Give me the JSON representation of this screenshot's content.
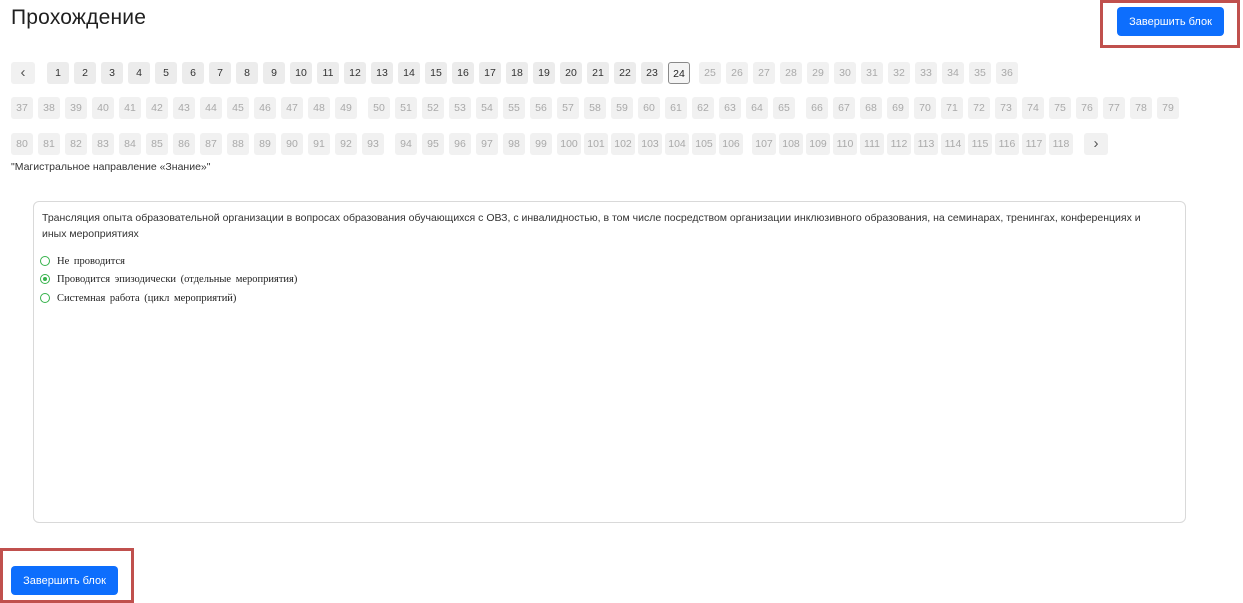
{
  "page": {
    "title": "Прохождение",
    "finish_button_label": "Завершить блок"
  },
  "pagination": {
    "current": 24,
    "rows": [
      {
        "items": [
          "1",
          "2",
          "3",
          "4",
          "5",
          "6",
          "7",
          "8",
          "9",
          "10",
          "11",
          "12",
          "13",
          "14",
          "15",
          "16",
          "17",
          "18",
          "19",
          "20",
          "21",
          "22",
          "23",
          "24",
          "25",
          "26",
          "27",
          "28",
          "29",
          "30",
          "31",
          "32",
          "33",
          "34",
          "35",
          "36"
        ]
      },
      {
        "items": [
          "37",
          "38",
          "39",
          "40",
          "41",
          "42",
          "43",
          "44",
          "45",
          "46",
          "47",
          "48",
          "49",
          "50",
          "51",
          "52",
          "53",
          "54",
          "55",
          "56",
          "57",
          "58",
          "59",
          "60",
          "61",
          "62",
          "63",
          "64",
          "65",
          "66",
          "67",
          "68",
          "69",
          "70",
          "71",
          "72",
          "73",
          "74",
          "75",
          "76",
          "77",
          "78",
          "79"
        ]
      },
      {
        "items": [
          "80",
          "81",
          "82",
          "83",
          "84",
          "85",
          "86",
          "87",
          "88",
          "89",
          "90",
          "91",
          "92",
          "93",
          "94",
          "95",
          "96",
          "97",
          "98",
          "99",
          "100",
          "101",
          "102",
          "103",
          "104",
          "105",
          "106",
          "107",
          "108",
          "109",
          "110",
          "111",
          "112",
          "113",
          "114",
          "115",
          "116",
          "117",
          "118"
        ]
      }
    ],
    "prev_icon": "chevron-left-icon",
    "next_icon": "chevron-right-icon"
  },
  "section": {
    "label": "\"Магистральное направление «Знание»\""
  },
  "question": {
    "text": "Трансляция опыта образовательной организации в вопросах образования обучающихся с ОВЗ, с инвалидностью, в том числе посредством организации инклюзивного образования, на семинарах, тренингах, конференциях и иных мероприятиях",
    "options": [
      {
        "label": "Не проводится",
        "checked": false
      },
      {
        "label": "Проводится эпизодически (отдельные мероприятия)",
        "checked": true
      },
      {
        "label": "Системная работа (цикл мероприятий)",
        "checked": false
      }
    ]
  },
  "colors": {
    "primary_button": "#0d6efd",
    "highlight_frame": "#c0504d",
    "radio_accent": "#35b24a"
  }
}
